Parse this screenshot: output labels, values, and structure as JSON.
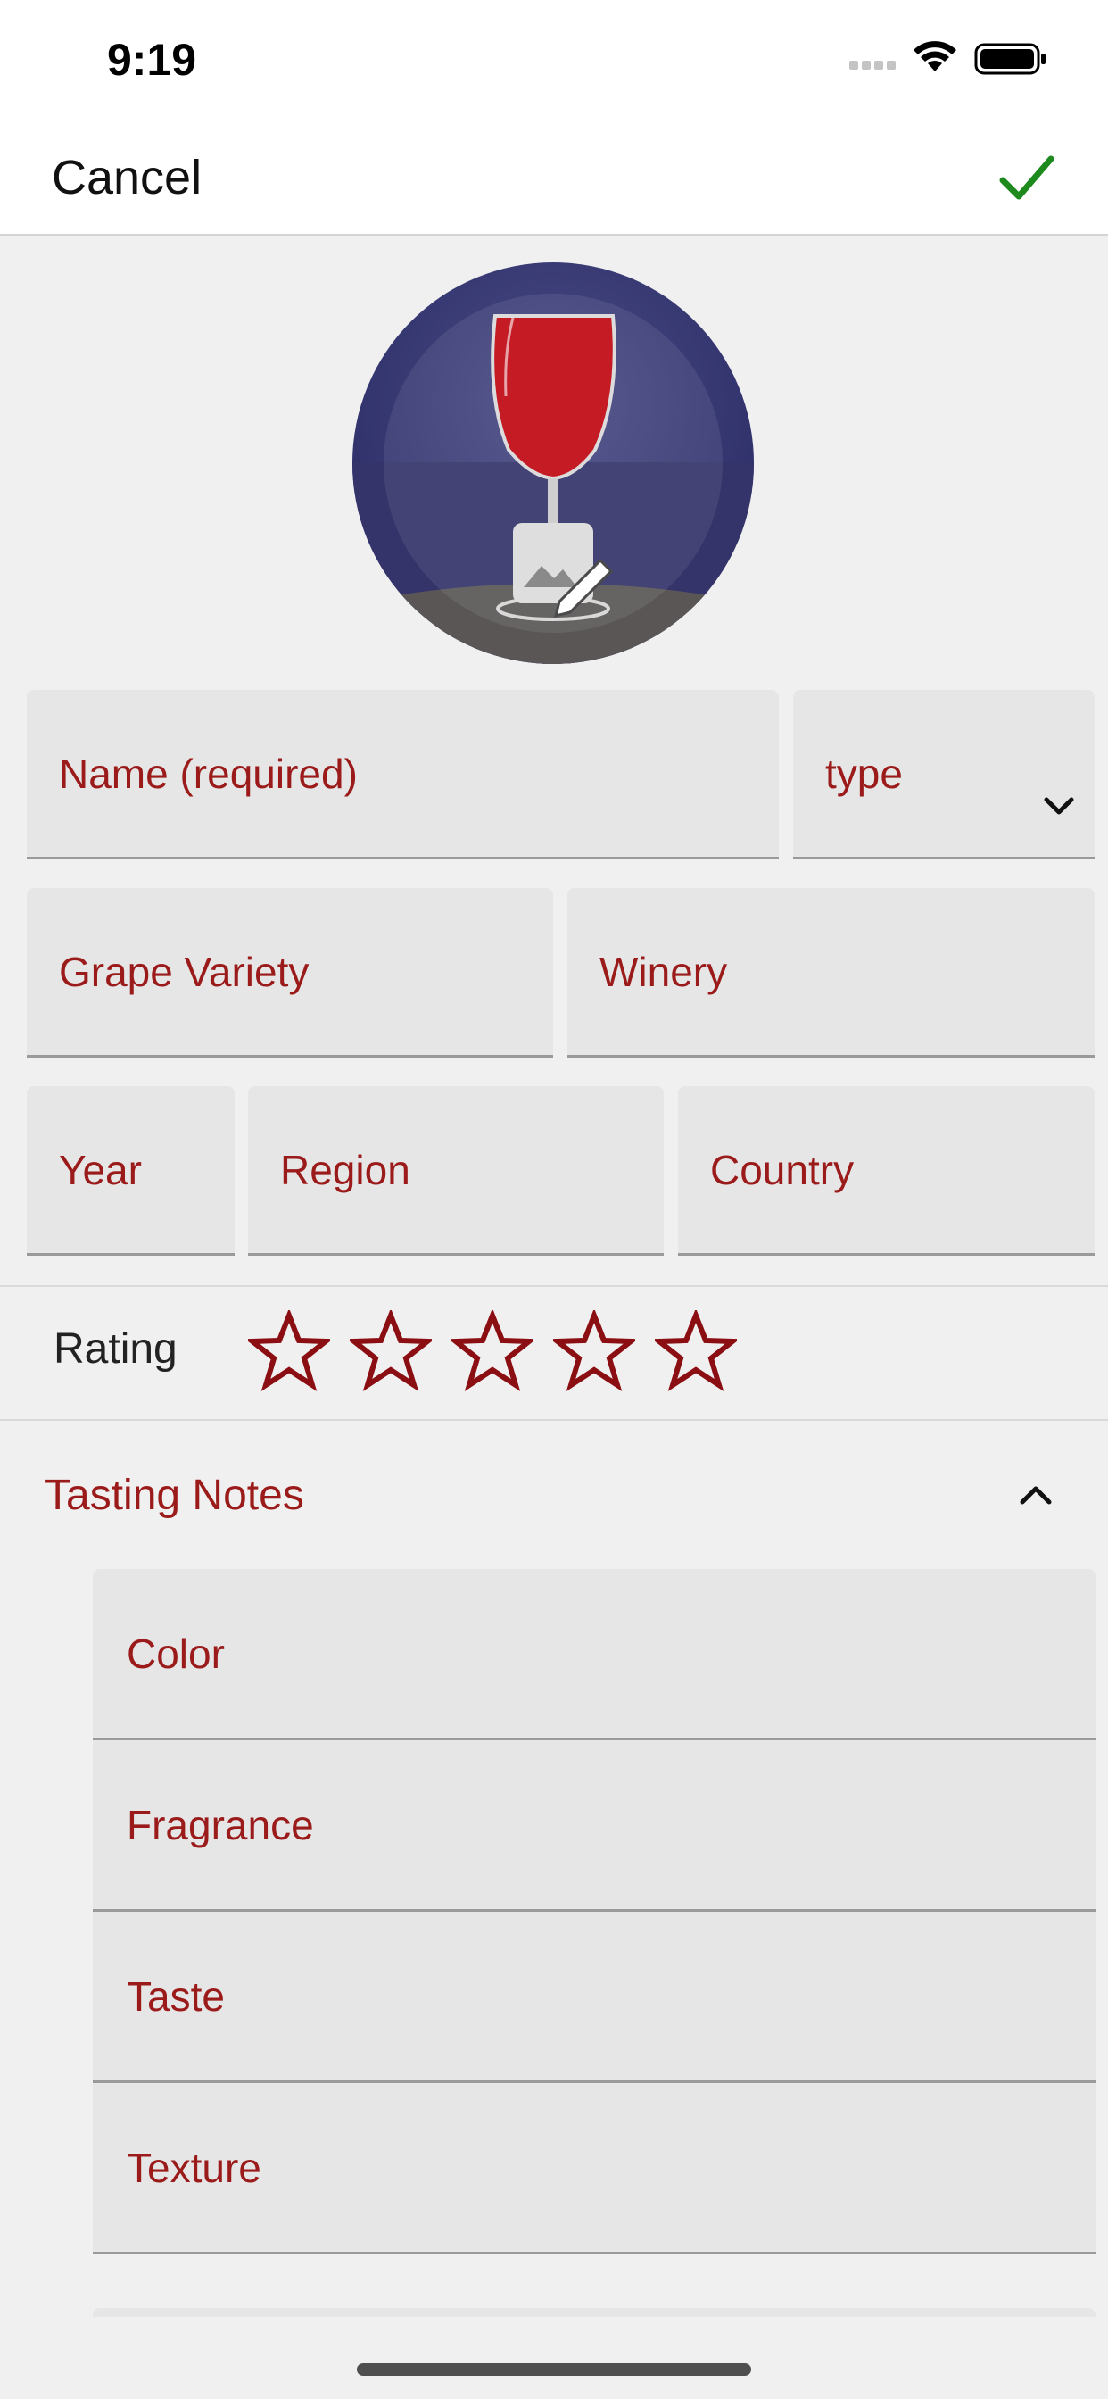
{
  "status": {
    "time": "9:19"
  },
  "nav": {
    "cancel_label": "Cancel",
    "done_icon": "checkmark-icon"
  },
  "photo": {
    "description_icon": "edit-photo-icon"
  },
  "fields": {
    "name": "Name  (required)",
    "type": "type",
    "grape_variety": "Grape Variety",
    "winery": "Winery",
    "year": "Year",
    "region": "Region",
    "country": "Country"
  },
  "rating": {
    "label": "Rating",
    "value": 0,
    "max": 5
  },
  "tasting": {
    "label": "Tasting Notes",
    "notes": [
      "Color",
      "Fragrance",
      "Taste",
      "Texture"
    ]
  },
  "colors": {
    "accent": "#9b1b1b",
    "done": "#1e8a1e",
    "field_bg": "#e6e6e6",
    "background": "#f0f0f0"
  }
}
